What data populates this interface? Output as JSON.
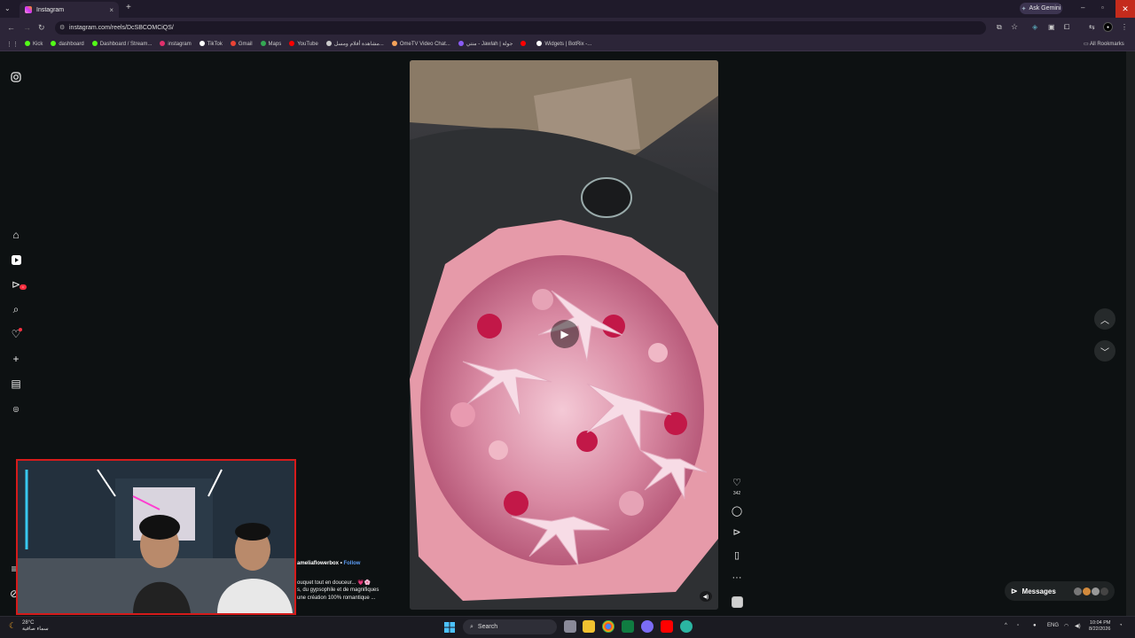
{
  "browser": {
    "tab_title": "Instagram",
    "tab_close": "×",
    "new_tab": "+",
    "url": "instagram.com/reels/DcSBCOMCiQS/",
    "ask_gemini": "Ask Gemini",
    "all_bookmarks": "All Rookmarks",
    "bookmarks": [
      {
        "label": "Kick",
        "color": "#53fc18"
      },
      {
        "label": "dashboard",
        "color": "#53fc18"
      },
      {
        "label": "Dashboard / Stream...",
        "color": "#53fc18"
      },
      {
        "label": "instagram",
        "color": "#e1306c"
      },
      {
        "label": "TikTok",
        "color": "#ffffff"
      },
      {
        "label": "Gmail",
        "color": "#ea4335"
      },
      {
        "label": "Maps",
        "color": "#34a853"
      },
      {
        "label": "YouTube",
        "color": "#ff0000"
      },
      {
        "label": "مشاهدة أفلام ومسل...",
        "color": "#cccccc"
      },
      {
        "label": "OmeTV Video Chat...",
        "color": "#f4a259"
      },
      {
        "label": "منتي - Jawlah | جولة",
        "color": "#8a5cf6"
      },
      {
        "label": "",
        "color": "#ff0000"
      },
      {
        "label": "Widgets | BotRix -...",
        "color": "#ffffff"
      }
    ]
  },
  "instagram": {
    "reel": {
      "username": "ameliaflowerbox",
      "follow": "Follow",
      "separator": "•",
      "caption_lines": [
        "ouquet tout en douceur... 💗🌸",
        "s, du gypsophile et de magnifiques",
        " une création 100% romantique ..."
      ],
      "likes": "342"
    },
    "messages_label": "Messages",
    "colors": {
      "accent": "#5b9cf5",
      "badge": "#ff3040"
    }
  },
  "taskbar": {
    "weather_temp": "28°C",
    "weather_desc": "سماء صافية",
    "search": "Search",
    "lang": "ENG",
    "time": "10:04 PM",
    "date": "8/22/2026"
  }
}
